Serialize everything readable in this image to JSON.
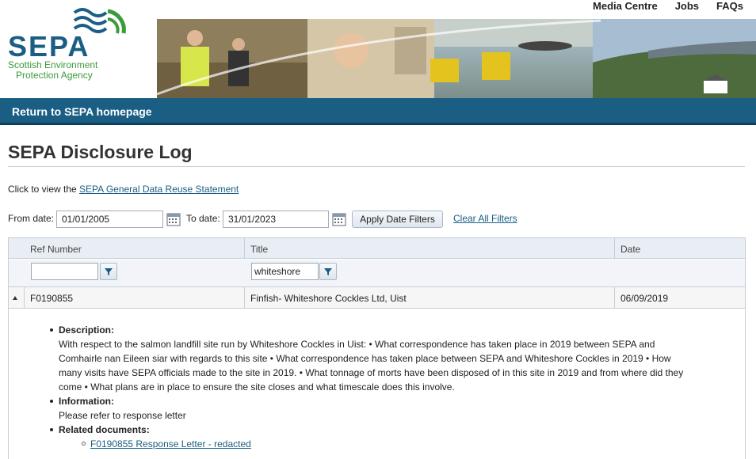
{
  "header": {
    "logo_text": "SEPA",
    "logo_sub_line1": "Scottish Environment",
    "logo_sub_line2": "Protection Agency",
    "nav": [
      "Media Centre",
      "Jobs",
      "FAQs"
    ]
  },
  "bluebar": {
    "link": "Return to SEPA homepage"
  },
  "page": {
    "title": "SEPA Disclosure Log",
    "reuse_prefix": "Click to view the ",
    "reuse_link": "SEPA General Data Reuse Statement"
  },
  "filters": {
    "from_label": "From date:",
    "from_value": "01/01/2005",
    "to_label": "To date:",
    "to_value": "31/01/2023",
    "apply_label": "Apply Date Filters",
    "clear_label": "Clear All Filters"
  },
  "grid": {
    "columns": [
      "Ref Number",
      "Title",
      "Date"
    ],
    "ref_filter_value": "",
    "title_filter_value": "whiteshore",
    "row": {
      "ref": "F0190855",
      "title": "Finfish- Whiteshore Cockles Ltd, Uist",
      "date": "06/09/2019"
    },
    "detail": {
      "description_label": "Description:",
      "description_text": "With respect to the salmon landfill site run by Whiteshore Cockles in Uist: • What correspondence has taken place in 2019 between SEPA and Comhairle nan Eileen siar with regards to this site • What correspondence has taken place between SEPA and Whiteshore Cockles in 2019 • How many visits have SEPA officials made to the site in 2019. • What tonnage of morts have been disposed of in this site in 2019 and from where did they come • What plans are in place to ensure the site closes and what timescale does this involve.",
      "information_label": "Information:",
      "information_text": "Please refer to response letter",
      "related_label": "Related documents:",
      "related_link": "F0190855 Response Letter - redacted"
    }
  },
  "colors": {
    "brand_blue": "#1a5e84",
    "brand_green": "#3a9b3a"
  }
}
